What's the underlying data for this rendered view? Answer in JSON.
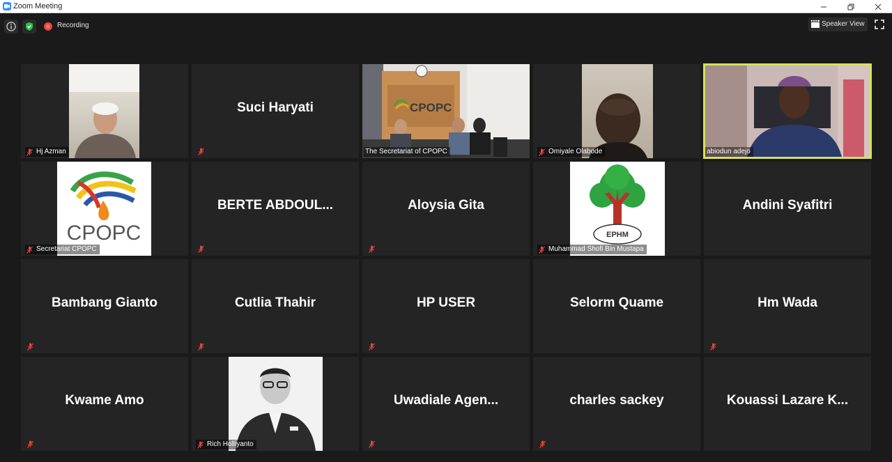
{
  "window": {
    "title": "Zoom Meeting"
  },
  "toolbar": {
    "recording_label": "Recording",
    "speaker_view_label": "Speaker View"
  },
  "colors": {
    "active_speaker_border": "#d6e05a",
    "mute_icon": "#e8453c",
    "tile_background": "#242424"
  },
  "tiles": [
    {
      "label": "Hj Azman",
      "video": true
    },
    {
      "label": "Suci Haryati",
      "video": false
    },
    {
      "label": "The Secretariat of CPOPC",
      "video": true
    },
    {
      "label": "Omiyale Olabode",
      "video": true
    },
    {
      "label": "abiodun adejo",
      "video": true,
      "active_speaker": true
    },
    {
      "label": "Secretariat CPOPC",
      "video": true,
      "logo_text": "CPOPC"
    },
    {
      "label": "BERTE  ABDOUL...",
      "video": false
    },
    {
      "label": "Aloysia Gita",
      "video": false
    },
    {
      "label": "Muhammad Shofi Bin Mustapa",
      "video": true,
      "logo_text": "EPHM"
    },
    {
      "label": "Andini Syafitri",
      "video": false
    },
    {
      "label": "Bambang Gianto",
      "video": false
    },
    {
      "label": "Cutlia Thahir",
      "video": false
    },
    {
      "label": "HP USER",
      "video": false
    },
    {
      "label": "Selorm Quame",
      "video": false
    },
    {
      "label": "Hm Wada",
      "video": false
    },
    {
      "label": "Kwame  Amo",
      "video": false
    },
    {
      "label": "Rich Holliyanto",
      "video": true
    },
    {
      "label": "Uwadiale  Agen...",
      "video": false
    },
    {
      "label": "charles sackey",
      "video": false
    },
    {
      "label": "Kouassi  Lazare  K...",
      "video": false
    }
  ]
}
